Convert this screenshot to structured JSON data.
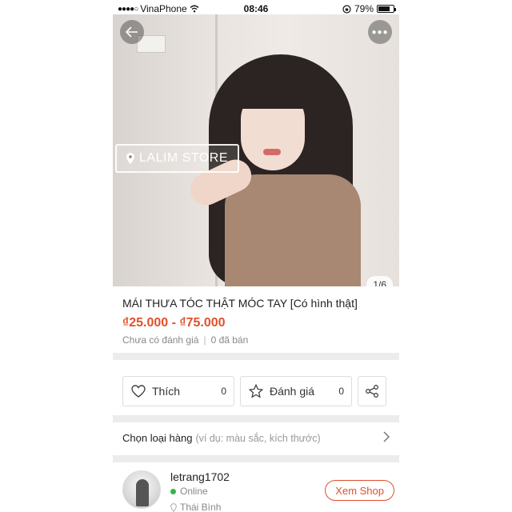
{
  "status_bar": {
    "carrier": "VinaPhone",
    "time": "08:46",
    "battery": "79%",
    "battery_level": 0.79
  },
  "gallery": {
    "store_badge": "LALIM STORE",
    "counter": "1/6"
  },
  "product": {
    "title": "MÁI THƯA TÓC THẬT MÓC TAY [Có hình thật]",
    "price": "₫25.000 - ₫75.000",
    "rating_text": "Chưa có đánh giá",
    "separator": "|",
    "sold_text": "0 đã bán"
  },
  "actions": {
    "like_label": "Thích",
    "like_count": "0",
    "rate_label": "Đánh giá",
    "rate_count": "0"
  },
  "variant": {
    "label": "Chọn loại hàng",
    "hint": "(ví dụ: màu sắc, kích thước)"
  },
  "seller": {
    "username": "letrang1702",
    "status": "Online",
    "location": "Thái Bình",
    "view_shop_label": "Xem Shop"
  },
  "colors": {
    "accent": "#e0502c",
    "online": "#33b54a"
  },
  "icons": {
    "back": "arrow-left-icon",
    "more": "more-icon",
    "like": "heart-icon",
    "rate": "star-icon",
    "share": "share-icon",
    "chevron": "chevron-right-icon",
    "location": "location-pin-icon"
  }
}
